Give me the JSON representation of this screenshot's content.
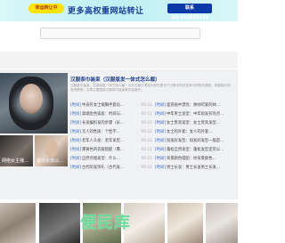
{
  "banner": {
    "badge": "幸运转让中",
    "headline": "更多高权重网站转让",
    "contact": "联系QQ:411025133"
  },
  "hero": {
    "thumb1_caption": "网络女主播…",
    "thumb2_caption": "受冷女孩以…"
  },
  "panel": {
    "title": "汉服茶巾装束（汉服版发一体式怎么裁）",
    "description": "汉服茶巾装束，汉服版发一体式怎么裁：今天汉服分享给大家的是关于汉服中的发型茶巾的相关搭配，希望能对您有所帮助，文章主要围绕汉服茶巾装束等内容展开。"
  },
  "list_left": [
    {
      "tag": "[时尚]",
      "text": "牛皮符女士缩胸手套钻…",
      "date": "05-11"
    },
    {
      "tag": "[时尚]",
      "text": "高端金色家居：时尚与…",
      "date": "05-11"
    },
    {
      "tag": "[时尚]",
      "text": "长发编织发的步骤（长…",
      "date": "05-11"
    },
    {
      "tag": "[时尚]",
      "text": "无人的性质：个性不…",
      "date": "05-11"
    },
    {
      "tag": "[时尚]",
      "text": "老年人头发：老年发型…",
      "date": "05-11"
    },
    {
      "tag": "[时尚]",
      "text": "熏黄色的衣服搭配（熏…",
      "date": "05-11"
    },
    {
      "tag": "[时尚]",
      "text": "自然点缀发型：什么…",
      "date": "05-11"
    },
    {
      "tag": "[时尚]",
      "text": "古代的发饰礼（古代发…",
      "date": "05-11"
    }
  ],
  "list_right": [
    {
      "tag": "[时尚]",
      "text": "鉴赏画中漂亮：帅帅可爱的帅…",
      "date": ""
    },
    {
      "tag": "[时尚]",
      "text": "中年男士发型：中年短发有热点…",
      "date": ""
    },
    {
      "tag": "[时尚]",
      "text": "女士贵宾发型：女士贵宾发型…",
      "date": ""
    },
    {
      "tag": "[时尚]",
      "text": "女士的外套：女人的外套…",
      "date": ""
    },
    {
      "tag": "[时尚]",
      "text": "短发好发型：短发好发型一般是…",
      "date": ""
    },
    {
      "tag": "[时尚]",
      "text": "蓬松自然发型：蓬松发型还可以…",
      "date": ""
    },
    {
      "tag": "[时尚]",
      "text": "背景颜色搭配：纹背景颜色…",
      "date": ""
    },
    {
      "tag": "[时尚]",
      "text": "男士长发：男士长发男士长发…",
      "date": ""
    }
  ],
  "watermark": "便民库"
}
